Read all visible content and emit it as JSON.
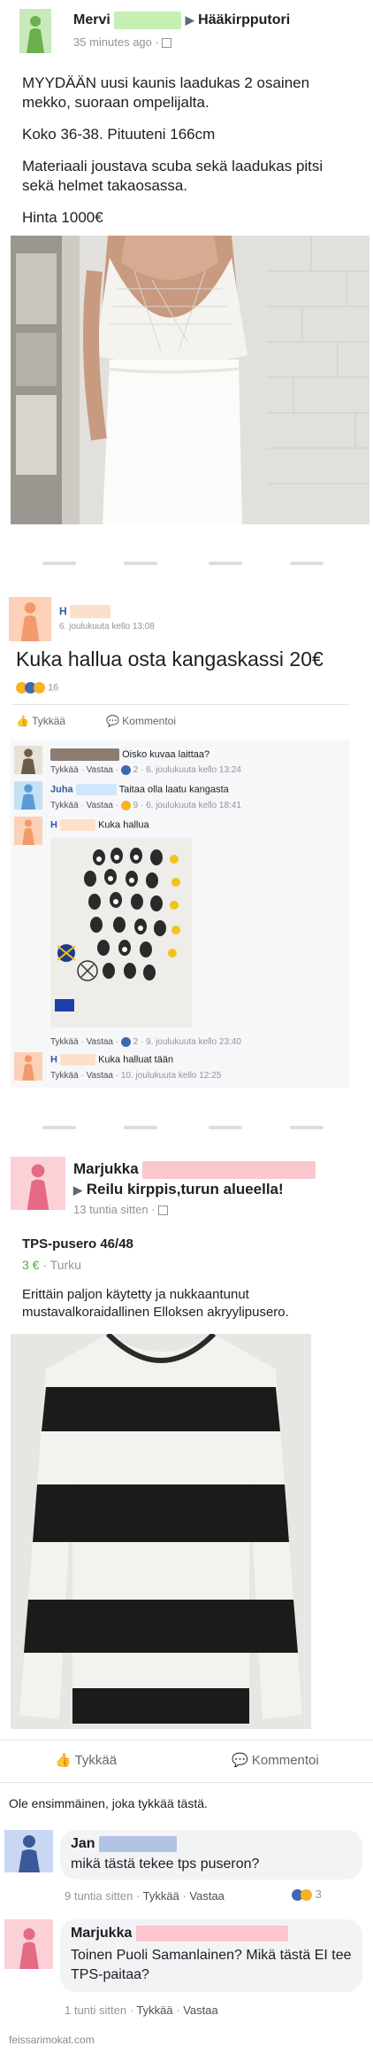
{
  "post1": {
    "author": "Mervi",
    "group": "Hääkirpputori",
    "time": "35 minutes ago",
    "text1": "MYYDÄÄN uusi kaunis laadukas 2 osainen mekko, suoraan ompelijalta.",
    "text2": "Koko 36-38. Pituuteni 166cm",
    "text3": "Materiaali joustava scuba sekä laadukas pitsi sekä helmet takaosassa.",
    "text4": "Hinta 1000€"
  },
  "post2": {
    "author": "H",
    "time": "6. joulukuuta kello 13:08",
    "text": "Kuka hallua osta kangaskassi 20€",
    "reaction_count": "16",
    "like_label": "Tykkää",
    "comment_label": "Kommentoi",
    "comments": [
      {
        "text": "Oisko kuvaa laittaa?",
        "reply": "Vastaa",
        "like": "Tykkää",
        "count": "2",
        "time": "6. joulukuuta kello 13:24"
      },
      {
        "author": "Juha",
        "text": "Taitaa olla laatu kangasta",
        "reply": "Vastaa",
        "like": "Tykkää",
        "count": "9",
        "time": "6. joulukuuta kello 18:41"
      },
      {
        "author": "H",
        "text": "Kuka hallua",
        "reply": "Vastaa",
        "like": "Tykkää",
        "count": "2",
        "time": "9. joulukuuta kello 23:40"
      },
      {
        "author": "H",
        "text": "Kuka halluat tään",
        "reply": "Vastaa",
        "like": "Tykkää",
        "time": "10. joulukuuta kello 12:25"
      }
    ]
  },
  "post3": {
    "author": "Marjukka",
    "group": "Reilu kirppis,turun alueella!",
    "time": "13 tuntia sitten",
    "item_title": "TPS-pusero 46/48",
    "price": "3 €",
    "location": "Turku",
    "description": "Erittäin paljon käytetty ja nukkaantunut mustavalkoraidallinen Elloksen akryylipusero.",
    "like_label": "Tykkää",
    "comment_label": "Kommentoi",
    "first_like": "Ole ensimmäinen, joka tykkää tästä.",
    "comments": [
      {
        "author": "Jan",
        "text": "mikä tästä tekee tps puseron?",
        "time": "9 tuntia sitten",
        "like": "Tykkää",
        "reply": "Vastaa",
        "count": "3"
      },
      {
        "author": "Marjukka",
        "text": "Toinen Puoli Samanlainen? Mikä tästä EI tee TPS-paitaa?",
        "time": "1 tunti sitten",
        "like": "Tykkää",
        "reply": "Vastaa"
      }
    ]
  },
  "watermark": "feissarimokat.com",
  "colors": {
    "accent_green": "#42b72a",
    "link_blue": "#365899",
    "like_blue": "#4267b2",
    "muted": "#90949c"
  }
}
